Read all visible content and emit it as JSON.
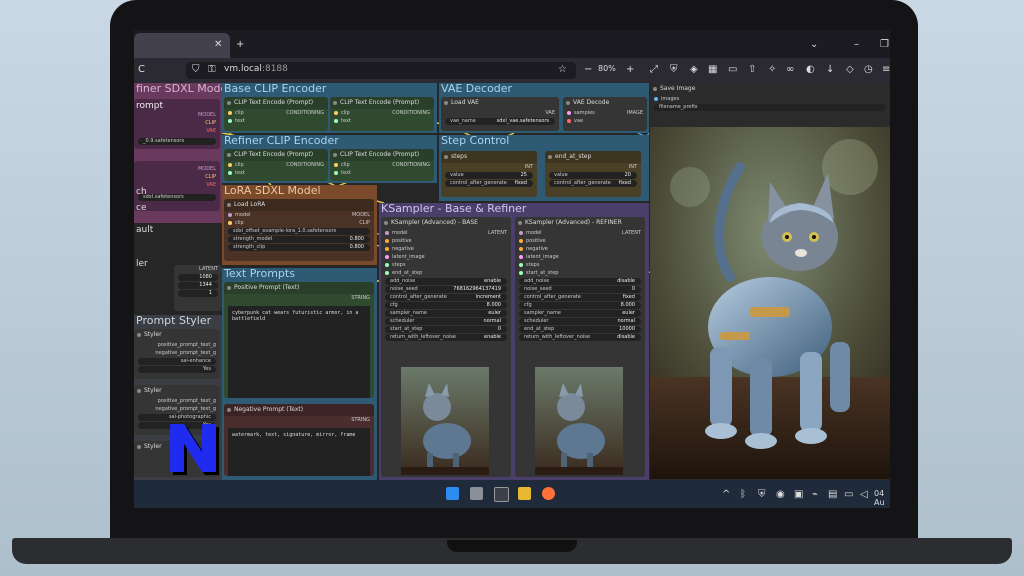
{
  "browser": {
    "tab_title": "",
    "url_host": "vm.local",
    "url_port": ":8188",
    "zoom": "80%"
  },
  "groups": {
    "refiner_model": "finer SDXL Model",
    "base_clip": "Base CLIP Encoder",
    "vae_decoder": "VAE Decoder",
    "refiner_clip": "Refiner CLIP Encoder",
    "step_control": "Step Control",
    "lora": "LoRA SDXL Model",
    "ksampler": "KSampler - Base & Refiner",
    "text_prompts": "Text Prompts",
    "prompt_styler": "Prompt Styler"
  },
  "left_column": {
    "prompt_label": "rompt",
    "items": [
      "ch",
      "ce",
      "ault",
      "ler"
    ],
    "sdxl_file": "sdxl.safetensors",
    "latent_label": "LATENT",
    "widgets": [
      {
        "value": "1080"
      },
      {
        "value": "1344"
      },
      {
        "value": "1"
      }
    ]
  },
  "styler": {
    "title": "Styler",
    "rows1": [
      "positive_prompt_text_g",
      "negative_prompt_text_g"
    ],
    "style1": "sai-enhance",
    "yes1": "Yes",
    "title2": "Styler",
    "rows2": [
      "positive_prompt_text_g",
      "negative_prompt_text_g"
    ],
    "style2": "sai-photographic",
    "yes2": "Yes",
    "title3": "Styler",
    "rows3": [
      "posit",
      "negat"
    ]
  },
  "nodes": {
    "clip_a": {
      "title": "CLIP Text Encode (Prompt)",
      "in1": "clip",
      "in2": "text",
      "out": "CONDITIONING"
    },
    "clip_b": {
      "title": "CLIP Text Encode (Prompt)",
      "in1": "clip",
      "in2": "text",
      "out": "CONDITIONING"
    },
    "clip_c": {
      "title": "CLIP Text Encode (Prompt)",
      "in1": "clip",
      "in2": "text",
      "out": "CONDITIONING"
    },
    "clip_d": {
      "title": "CLIP Text Encode (Prompt)",
      "in1": "clip",
      "in2": "text",
      "out": "CONDITIONING"
    },
    "load_vae": {
      "title": "Load VAE",
      "out": "VAE",
      "label": "vae_name",
      "value": "sdxl_vae.safetensors"
    },
    "vae_decode": {
      "title": "VAE Decode",
      "in1": "samples",
      "in2": "vae",
      "out": "IMAGE"
    },
    "steps": {
      "title": "steps",
      "out": "INT",
      "value_label": "value",
      "value": "25",
      "control_label": "control_after_generate",
      "control_value": "fixed"
    },
    "end_at_step": {
      "title": "end_at_step",
      "out": "INT",
      "value_label": "value",
      "value": "20",
      "control_label": "control_after_generate",
      "control_value": "fixed"
    },
    "load_lora": {
      "title": "Load LoRA",
      "in1": "model",
      "in2": "clip",
      "out1": "MODEL",
      "out2": "CLIP",
      "lora_name": "sdxl_offset_example-lora_1.0.safetensors",
      "w1_label": "strength_model",
      "w1_value": "0.800",
      "w2_label": "strength_clip",
      "w2_value": "0.800"
    },
    "positive": {
      "title": "Positive Prompt (Text)",
      "out": "STRING",
      "text": "cyberpunk cat wears futuristic armor, in a battlefield"
    },
    "negative": {
      "title": "Negative Prompt (Text)",
      "out": "STRING",
      "text": "watermark, text, signature, mirror, frame"
    },
    "ks_base": {
      "title": "KSampler (Advanced) - BASE",
      "out": "LATENT",
      "inputs": [
        "model",
        "positive",
        "negative",
        "latent_image",
        "steps",
        "end_at_step"
      ],
      "widgets": [
        {
          "label": "add_noise",
          "value": "enable"
        },
        {
          "label": "noise_seed",
          "value": "768162964137419"
        },
        {
          "label": "control_after_generate",
          "value": "increment"
        },
        {
          "label": "cfg",
          "value": "8.000"
        },
        {
          "label": "sampler_name",
          "value": "euler"
        },
        {
          "label": "scheduler",
          "value": "normal"
        },
        {
          "label": "start_at_step",
          "value": "0"
        },
        {
          "label": "return_with_leftover_noise",
          "value": "enable"
        }
      ]
    },
    "ks_refiner": {
      "title": "KSampler (Advanced) - REFINER",
      "out": "LATENT",
      "inputs": [
        "model",
        "positive",
        "negative",
        "latent_image",
        "steps",
        "start_at_step"
      ],
      "widgets": [
        {
          "label": "add_noise",
          "value": "disable"
        },
        {
          "label": "noise_seed",
          "value": "0"
        },
        {
          "label": "control_after_generate",
          "value": "fixed"
        },
        {
          "label": "cfg",
          "value": "8.000"
        },
        {
          "label": "sampler_name",
          "value": "euler"
        },
        {
          "label": "scheduler",
          "value": "normal"
        },
        {
          "label": "end_at_step",
          "value": "10000"
        },
        {
          "label": "return_with_leftover_noise",
          "value": "disable"
        }
      ]
    },
    "save_image": {
      "title": "Save Image",
      "in": "images",
      "prefix_value": "filename_prefix"
    }
  },
  "left_model": {
    "outs": [
      "MODEL",
      "CLIP",
      "VAE"
    ],
    "outs2": [
      "MODEL",
      "CLIP",
      "VAE"
    ],
    "ckpt": "_0.9.safetensors",
    "ckpt2": "sdxl.safetensors"
  },
  "taskbar": {
    "date": "04 Au"
  },
  "colors": {
    "accent_yellow": "#e8c547",
    "accent_blue": "#4fa3e0",
    "logo_blue": "#1f2cf0"
  }
}
